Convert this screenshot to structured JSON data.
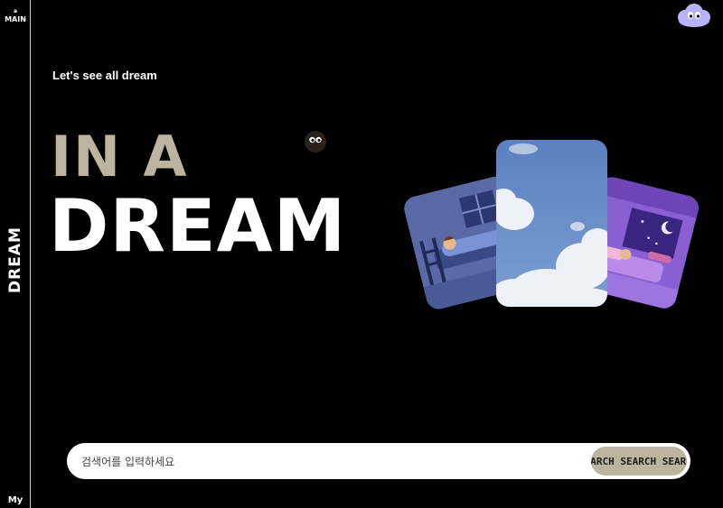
{
  "nav": {
    "home_prefix": "a",
    "home_label": "MAIN",
    "brand_vertical": "DREAM",
    "my_label": "My"
  },
  "hero": {
    "subtitle": "Let's see all dream",
    "line1": "IN A",
    "line2": "DREAM"
  },
  "search": {
    "placeholder": "검색어를 입력하세요",
    "button_text": "SEARCH SEARCH SEARCH"
  },
  "colors": {
    "accent": "#bdb49f",
    "background": "#000000",
    "avatar": "#b7b3ff"
  },
  "icons": {
    "avatar": "cloud-avatar-icon",
    "mascot": "soot-sprite-icon"
  },
  "gallery": {
    "cards": [
      "sleeping-room-illustration",
      "sky-clouds-photo",
      "purple-bedroom-illustration"
    ]
  }
}
